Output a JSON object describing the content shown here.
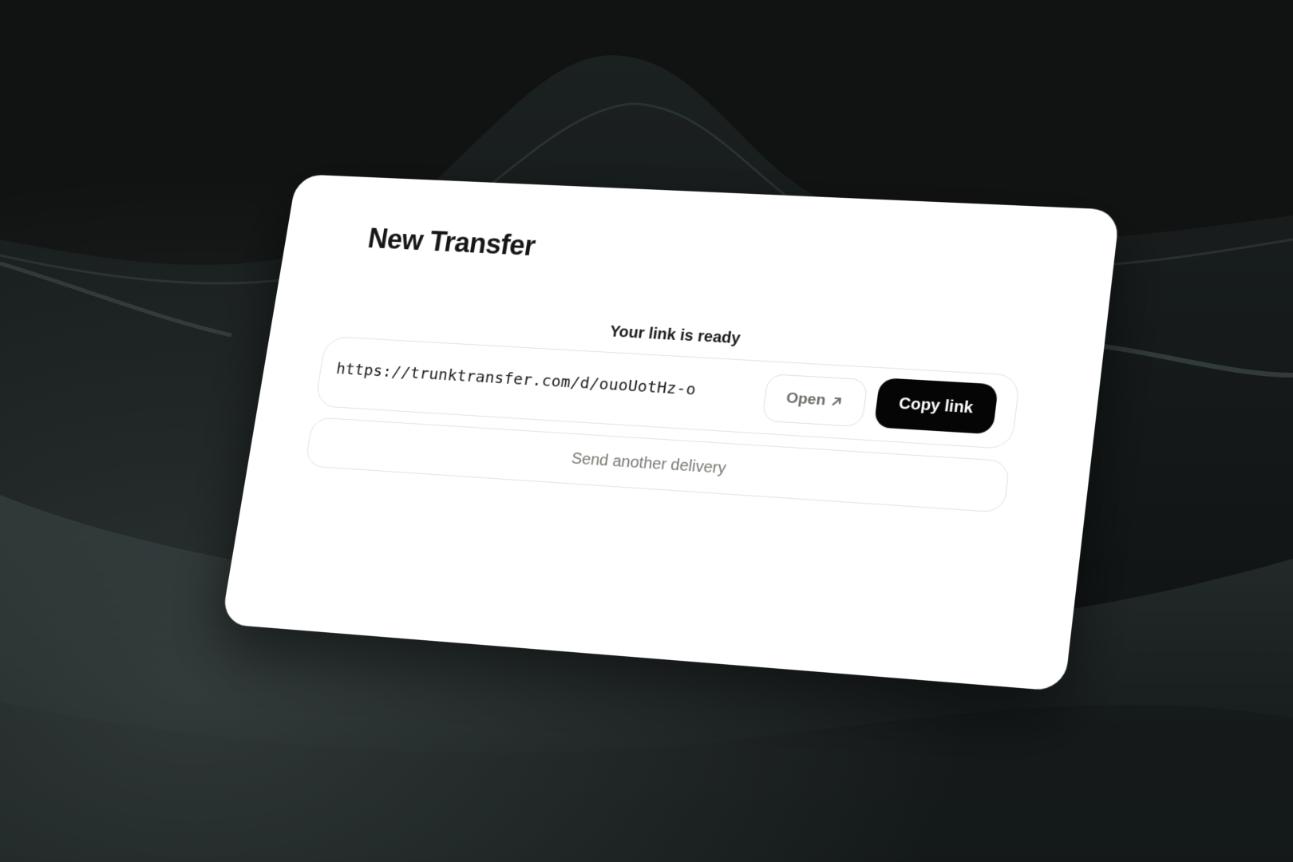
{
  "dialog": {
    "title": "New Transfer",
    "status_label": "Your link is ready",
    "link_url": "https://trunktransfer.com/d/ouoUotHz-o",
    "open_label": "Open",
    "open_icon": "arrow-up-right-icon",
    "copy_label": "Copy link",
    "send_another_label": "Send another delivery"
  },
  "colors": {
    "background": "#111313",
    "card": "#ffffff",
    "primary_button": "#050505",
    "border": "#e6e2dc",
    "muted_text": "#7a7671"
  }
}
